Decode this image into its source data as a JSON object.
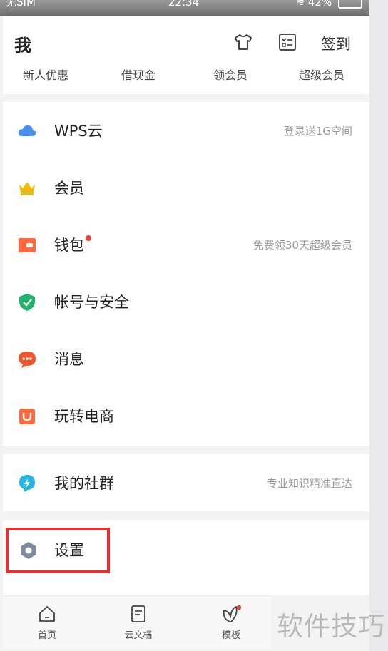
{
  "status_bar": {
    "carrier": "无SIM",
    "time": "22:34",
    "battery": "42%"
  },
  "header": {
    "title": "我",
    "sign_in": "签到",
    "quick_links": [
      "新人优惠",
      "借现金",
      "领会员",
      "超级会员"
    ]
  },
  "menu1": [
    {
      "label": "WPS云",
      "sub": "登录送1G空间",
      "icon": "cloud-icon",
      "color": "#4a8ff0"
    },
    {
      "label": "会员",
      "sub": "",
      "icon": "crown-icon",
      "color": "#f5b800"
    },
    {
      "label": "钱包",
      "sub": "免费领30天超级会员",
      "icon": "wallet-icon",
      "color": "#ff6a3d",
      "badge": true
    },
    {
      "label": "帐号与安全",
      "sub": "",
      "icon": "shield-icon",
      "color": "#1fb26b"
    },
    {
      "label": "消息",
      "sub": "",
      "icon": "chat-bubble-icon",
      "color": "#f0562a"
    },
    {
      "label": "玩转电商",
      "sub": "",
      "icon": "shopping-bag-icon",
      "color": "#ff6a3d"
    }
  ],
  "menu2": [
    {
      "label": "我的社群",
      "sub": "专业知识精准直达",
      "icon": "community-icon",
      "color": "#27b4e0"
    }
  ],
  "menu3": [
    {
      "label": "设置",
      "sub": "",
      "icon": "settings-hex-icon",
      "color": "#7f8c9f"
    }
  ],
  "bottom_nav": [
    {
      "label": "首页",
      "icon": "home-icon"
    },
    {
      "label": "云文档",
      "icon": "document-icon"
    },
    {
      "label": "模板",
      "icon": "template-leaf-icon",
      "badge": true
    }
  ],
  "watermark": "软件技巧"
}
